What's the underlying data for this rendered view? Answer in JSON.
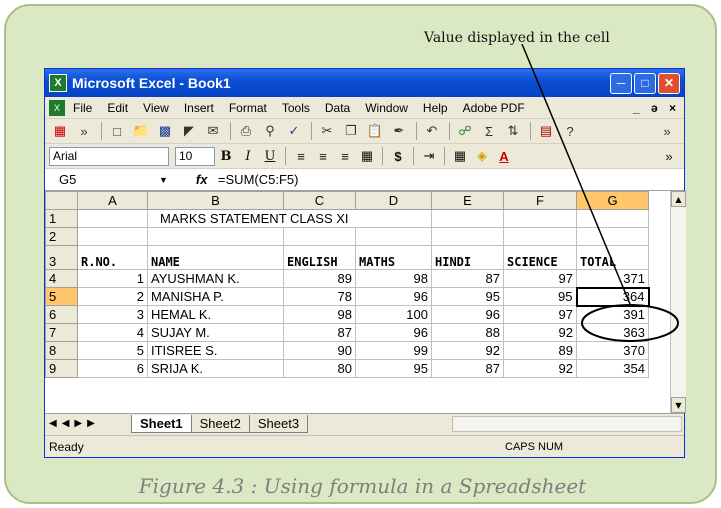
{
  "callout_text": "Value displayed in the cell",
  "caption": "Figure 4.3 : Using formula in a Spreadsheet",
  "window": {
    "title": "Microsoft Excel - Book1",
    "app_icon_glyph": "X"
  },
  "menus": [
    "File",
    "Edit",
    "View",
    "Insert",
    "Format",
    "Tools",
    "Data",
    "Window",
    "Help",
    "Adobe PDF"
  ],
  "menu_right": "_ ə ×",
  "formatting": {
    "font": "Arial",
    "size": "10"
  },
  "formula_bar": {
    "cell_ref": "G5",
    "formula": "=SUM(C5:F5)"
  },
  "columns": [
    "A",
    "B",
    "C",
    "D",
    "E",
    "F",
    "G"
  ],
  "row_numbers": [
    "1",
    "2",
    "3",
    "4",
    "5",
    "6",
    "7",
    "8",
    "9"
  ],
  "rows": {
    "r1": {
      "title": "MARKS STATEMENT CLASS XI"
    },
    "r3": {
      "a": "R.NO.",
      "b": "NAME",
      "c": "ENGLISH",
      "d": "MATHS",
      "e": "HINDI",
      "f": "SCIENCE",
      "g": "TOTAL"
    },
    "students": [
      {
        "rno": "1",
        "name": "AYUSHMAN K.",
        "english": "89",
        "maths": "98",
        "hindi": "87",
        "science": "97",
        "total": "371"
      },
      {
        "rno": "2",
        "name": "MANISHA P.",
        "english": "78",
        "maths": "96",
        "hindi": "95",
        "science": "95",
        "total": "364"
      },
      {
        "rno": "3",
        "name": "HEMAL K.",
        "english": "98",
        "maths": "100",
        "hindi": "96",
        "science": "97",
        "total": "391"
      },
      {
        "rno": "4",
        "name": "SUJAY M.",
        "english": "87",
        "maths": "96",
        "hindi": "88",
        "science": "92",
        "total": "363"
      },
      {
        "rno": "5",
        "name": "ITISREE S.",
        "english": "90",
        "maths": "99",
        "hindi": "92",
        "science": "89",
        "total": "370"
      },
      {
        "rno": "6",
        "name": "SRIJA K.",
        "english": "80",
        "maths": "95",
        "hindi": "87",
        "science": "92",
        "total": "354"
      }
    ]
  },
  "sheets": [
    "Sheet1",
    "Sheet2",
    "Sheet3"
  ],
  "status": {
    "left": "Ready",
    "right": "CAPS NUM"
  },
  "colors": {
    "frame_bg": "#dbe8c4",
    "selection_header": "#ffc66b",
    "titlebar": "#0a4fd6"
  }
}
